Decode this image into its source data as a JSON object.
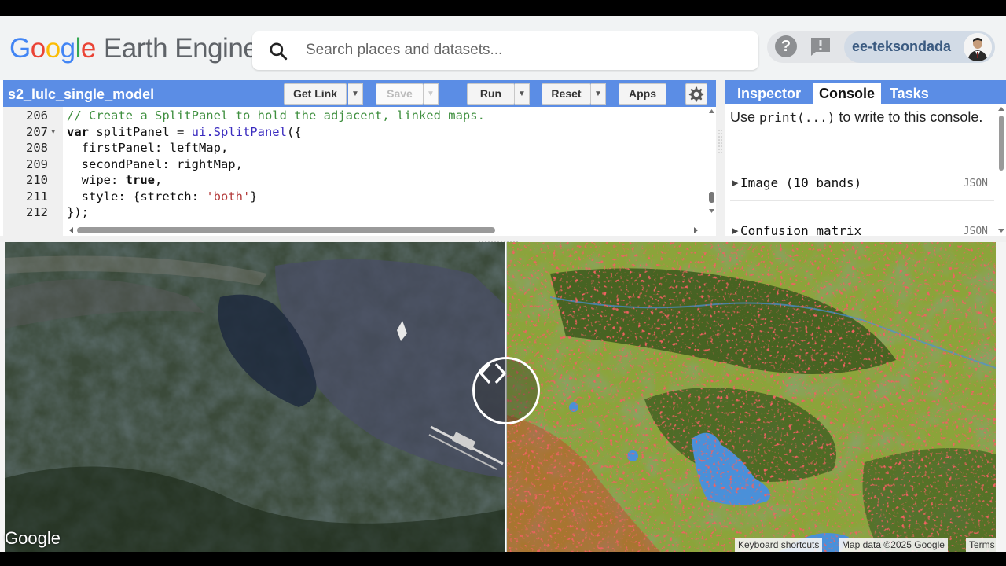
{
  "header": {
    "logo_google": [
      "G",
      "o",
      "o",
      "g",
      "l",
      "e"
    ],
    "logo_product": "Earth Engine",
    "search_placeholder": "Search places and datasets...",
    "user_name": "ee-teksondada"
  },
  "editor": {
    "script_name": "s2_lulc_single_model",
    "buttons": {
      "get_link": "Get Link",
      "save": "Save",
      "run": "Run",
      "reset": "Reset",
      "apps": "Apps"
    },
    "lines": [
      {
        "num": "206",
        "fold": "",
        "segments": [
          {
            "t": "// Create a SplitPanel to hold the adjacent, linked maps.",
            "c": "cm"
          }
        ]
      },
      {
        "num": "207",
        "fold": "▼",
        "segments": [
          {
            "t": "var",
            "c": "kw"
          },
          {
            "t": " splitPanel = ",
            "c": ""
          },
          {
            "t": "ui.SplitPanel",
            "c": "fn"
          },
          {
            "t": "({",
            "c": ""
          }
        ]
      },
      {
        "num": "208",
        "fold": "",
        "segments": [
          {
            "t": "  firstPanel: leftMap,",
            "c": ""
          }
        ]
      },
      {
        "num": "209",
        "fold": "",
        "segments": [
          {
            "t": "  secondPanel: rightMap,",
            "c": ""
          }
        ]
      },
      {
        "num": "210",
        "fold": "",
        "segments": [
          {
            "t": "  wipe: ",
            "c": ""
          },
          {
            "t": "true",
            "c": "kw"
          },
          {
            "t": ",",
            "c": ""
          }
        ]
      },
      {
        "num": "211",
        "fold": "",
        "segments": [
          {
            "t": "  style: {stretch: ",
            "c": ""
          },
          {
            "t": "'both'",
            "c": "str"
          },
          {
            "t": "}",
            "c": ""
          }
        ]
      },
      {
        "num": "212",
        "fold": "",
        "segments": [
          {
            "t": "});",
            "c": ""
          }
        ]
      }
    ]
  },
  "right_panel": {
    "tabs": [
      "Inspector",
      "Console",
      "Tasks"
    ],
    "active_tab": "Console",
    "console_intro_1": "Use ",
    "console_intro_code": "print(...)",
    "console_intro_2": " to write to this console.",
    "entries": [
      {
        "label": "Image (10 bands)",
        "badge": "JSON"
      },
      {
        "label": "Confusion matrix",
        "badge": "JSON"
      }
    ]
  },
  "map": {
    "watermark": "Google",
    "attributions": [
      "Keyboard shortcuts",
      "Map data ©2025 Google",
      "Terms"
    ],
    "split_position_fraction": 0.503,
    "colors": {
      "forest": "#3f5c1f",
      "cropland": "#8ba43a",
      "water": "#4a90d9",
      "built": "#e02020",
      "bare": "#9a9a9a"
    }
  }
}
